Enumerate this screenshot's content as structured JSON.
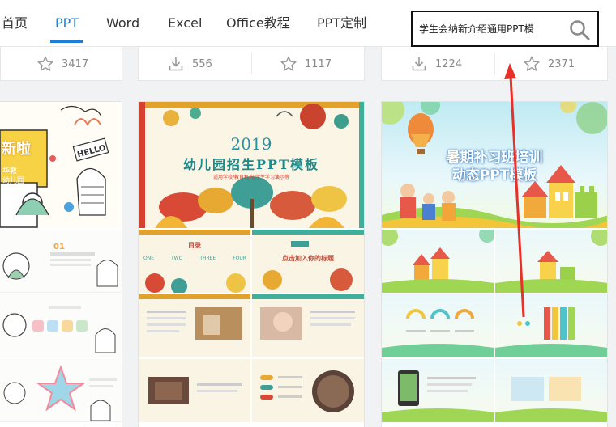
{
  "nav": {
    "items": [
      {
        "label": "首页",
        "active": false
      },
      {
        "label": "PPT",
        "active": true
      },
      {
        "label": "Word",
        "active": false
      },
      {
        "label": "Excel",
        "active": false
      },
      {
        "label": "Office教程",
        "active": false
      },
      {
        "label": "PPT定制",
        "active": false
      }
    ],
    "search_value": "学生会纳新介绍通用PPT模",
    "search_icon": "search-icon"
  },
  "stats": {
    "card1": {
      "stars": "3417"
    },
    "card2": {
      "downloads": "556",
      "stars": "1117"
    },
    "card3": {
      "downloads": "1224",
      "stars": "2371"
    }
  },
  "cards": {
    "card1": {
      "cover_text_1": "新啦",
      "cover_text_2": "HELLO",
      "cover_lines": [
        "华教",
        "幼儿园",
        "长教育"
      ],
      "slide_number": "01"
    },
    "card2": {
      "year": "2019",
      "title": "幼儿园招生PPT模板",
      "subtitle": "适用学校/教育机构/学生学习演示等",
      "toc_title": "目录",
      "toc_items": [
        "ONE",
        "TWO",
        "THREE",
        "FOUR"
      ],
      "slide2_title": "点击加入你的标题"
    },
    "card3": {
      "title_line1": "暑期补习班培训",
      "title_line2": "动态PPT模板"
    }
  },
  "colors": {
    "accent": "#1e7fd8",
    "arrow": "#e8302a"
  }
}
